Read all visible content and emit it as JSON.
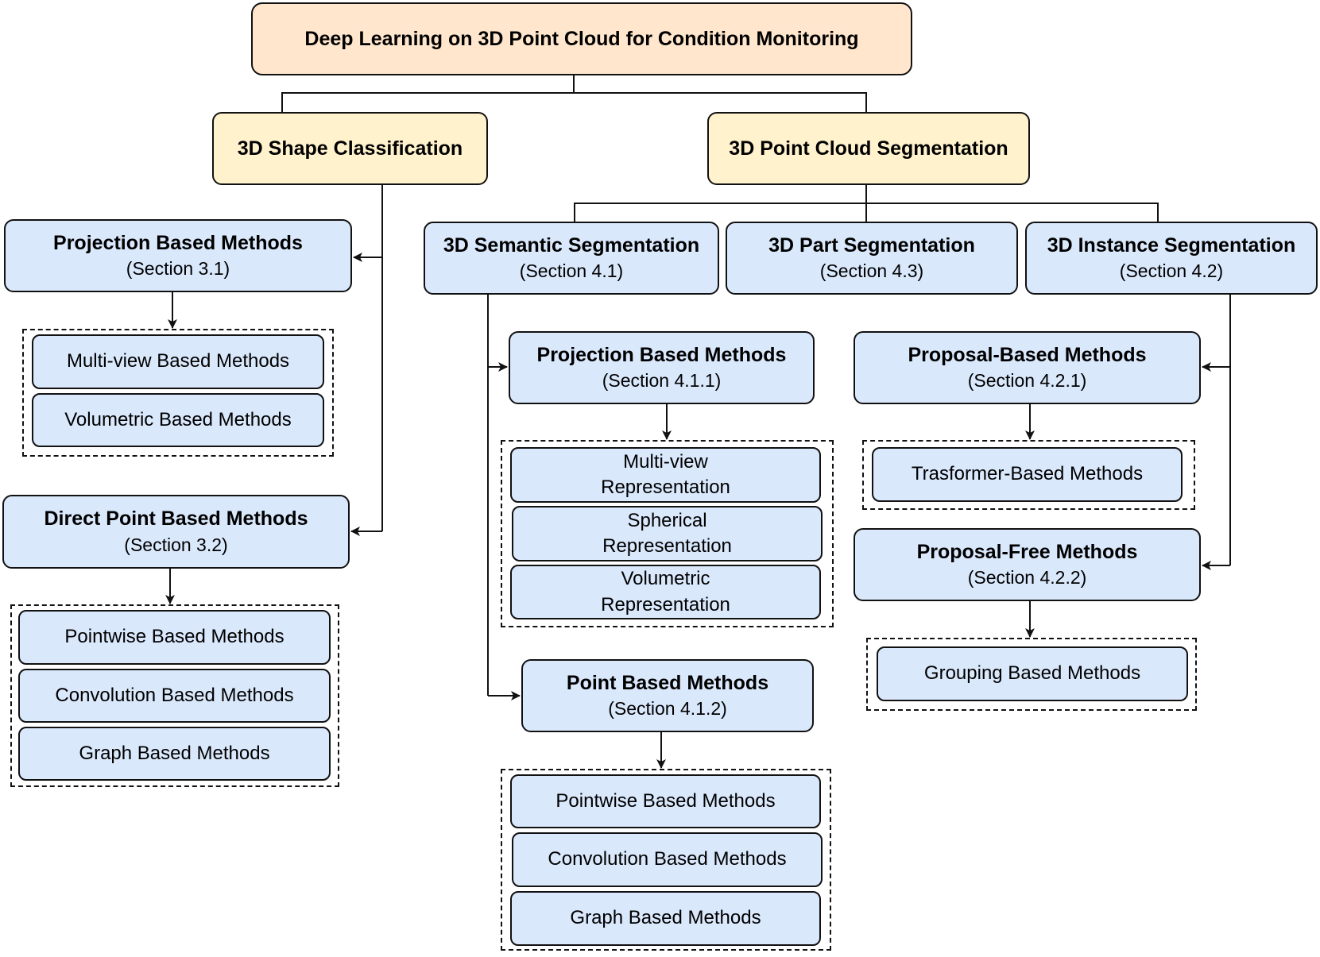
{
  "diagram": {
    "root": "Deep Learning on 3D Point Cloud for Condition Monitoring",
    "classification": {
      "title": "3D Shape Classification",
      "projection": {
        "title": "Projection Based Methods",
        "section": "(Section 3.1)",
        "items": [
          "Multi-view Based Methods",
          "Volumetric Based Methods"
        ]
      },
      "direct": {
        "title": "Direct Point Based Methods",
        "section": "(Section 3.2)",
        "items": [
          "Pointwise Based Methods",
          "Convolution Based Methods",
          "Graph Based Methods"
        ]
      }
    },
    "segmentation": {
      "title": "3D Point Cloud Segmentation",
      "semantic": {
        "title": "3D Semantic Segmentation",
        "section": "(Section 4.1)",
        "projection": {
          "title": "Projection Based Methods",
          "section": "(Section 4.1.1)",
          "items": [
            "Multi-view Representation",
            "Spherical Representation",
            "Volumetric Representation"
          ]
        },
        "point": {
          "title": "Point Based Methods",
          "section": "(Section 4.1.2)",
          "items": [
            "Pointwise Based Methods",
            "Convolution Based Methods",
            "Graph Based Methods"
          ]
        }
      },
      "part": {
        "title": "3D Part Segmentation",
        "section": "(Section 4.3)"
      },
      "instance": {
        "title": "3D Instance Segmentation",
        "section": "(Section 4.2)",
        "proposal_based": {
          "title": "Proposal-Based Methods",
          "section": "(Section 4.2.1)",
          "items": [
            "Trasformer-Based Methods"
          ]
        },
        "proposal_free": {
          "title": "Proposal-Free Methods",
          "section": "(Section 4.2.2)",
          "items": [
            "Grouping Based Methods"
          ]
        }
      }
    }
  }
}
